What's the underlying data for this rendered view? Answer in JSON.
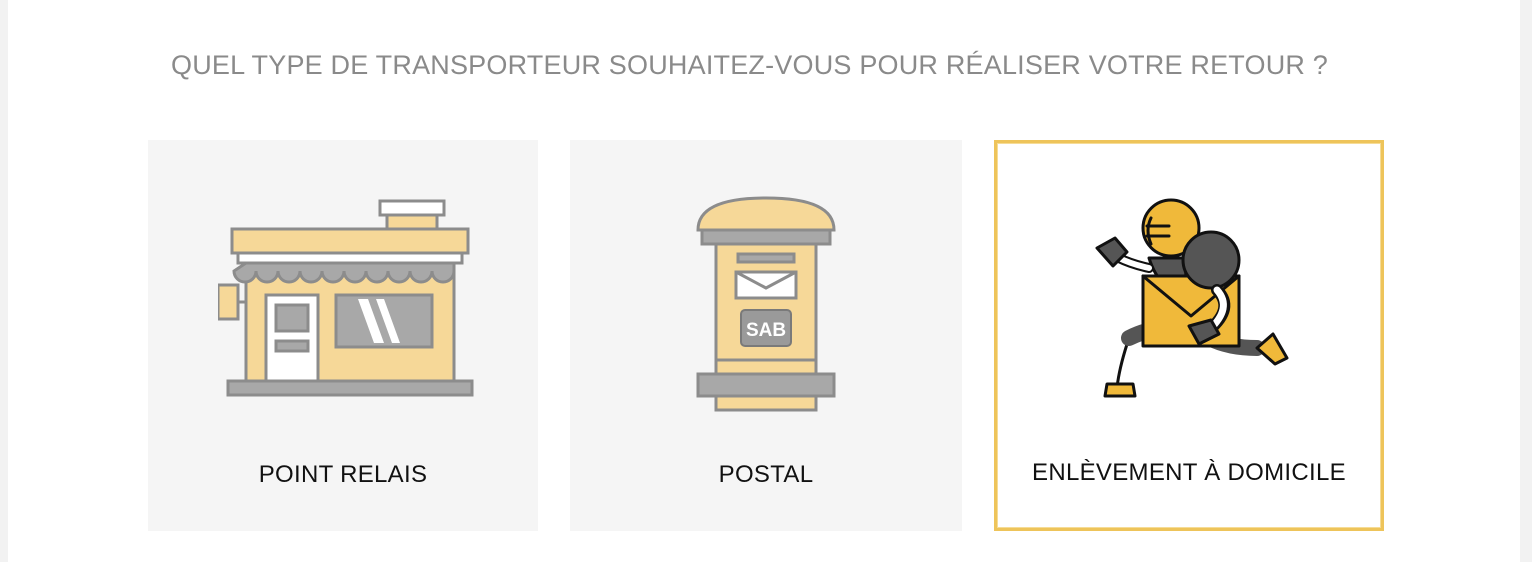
{
  "question": "QUEL TYPE DE TRANSPORTEUR SOUHAITEZ-VOUS POUR RÉALISER VOTRE RETOUR ?",
  "options": [
    {
      "label": "POINT RELAIS",
      "icon": "shop-icon",
      "selected": false
    },
    {
      "label": "POSTAL",
      "icon": "mailbox-icon",
      "selected": false
    },
    {
      "label": "ENLÈVEMENT À DOMICILE",
      "icon": "courier-runner-icon",
      "selected": true
    }
  ],
  "mailbox_logo_text": "SAB",
  "colors": {
    "accent": "#eec45a",
    "icon_fill": "#f6d898",
    "icon_stroke": "#8c8c8c",
    "question_text": "#8a8a8a"
  }
}
